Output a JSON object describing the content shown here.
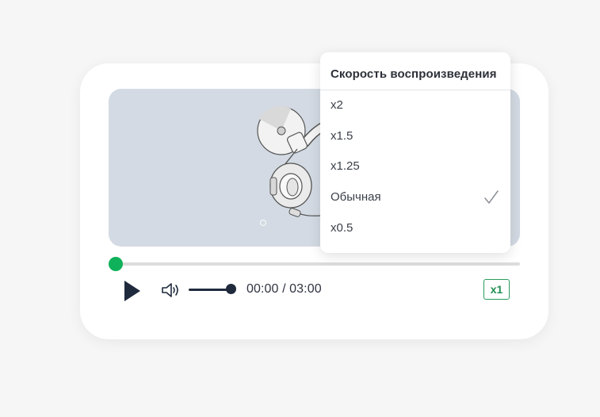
{
  "player": {
    "time_display": "00:00 / 03:00",
    "progress": 0,
    "volume": 1,
    "speed_badge": "x1",
    "accent_color": "#0fb15a"
  },
  "speed_menu": {
    "title": "Скорость воспроизведения",
    "options": [
      {
        "label": "x2",
        "selected": false
      },
      {
        "label": "x1.5",
        "selected": false
      },
      {
        "label": "x1.25",
        "selected": false
      },
      {
        "label": "Обычная",
        "selected": true
      },
      {
        "label": "x0.5",
        "selected": false
      }
    ]
  },
  "icons": [
    "play-icon",
    "volume-icon",
    "checkmark-icon",
    "headphones-icon",
    "disc-icon"
  ]
}
